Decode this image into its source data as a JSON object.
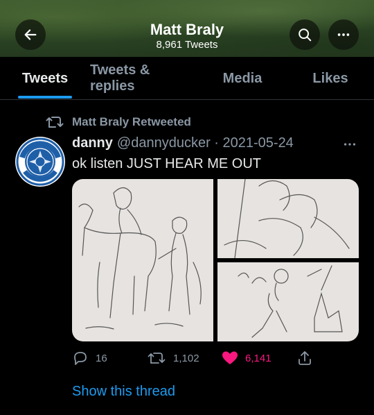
{
  "header": {
    "title": "Matt Braly",
    "subtitle": "8,961 Tweets",
    "back_icon": "arrow-left-icon",
    "search_icon": "search-icon",
    "more_icon": "more-horizontal-icon"
  },
  "tabs": [
    {
      "label": "Tweets",
      "active": true
    },
    {
      "label": "Tweets & replies",
      "active": false
    },
    {
      "label": "Media",
      "active": false
    },
    {
      "label": "Likes",
      "active": false
    }
  ],
  "tweet": {
    "retweet_label": "Matt Braly Retweeted",
    "author_name": "danny",
    "handle_date": "@dannyducker · 2021-05-24",
    "text": "ok listen JUST HEAR ME OUT",
    "avatar_text_top": "SUPPORT",
    "avatar_text_bottom": "STRIKE",
    "avatar_center": "IA",
    "actions": {
      "reply_count": "16",
      "retweet_count": "1,102",
      "like_count": "6,141",
      "liked": true
    },
    "show_thread": "Show this thread"
  },
  "colors": {
    "accent": "#1d9bf0",
    "like": "#f91880",
    "muted": "#8b98a5",
    "avatar_blue": "#1f5fa8"
  }
}
